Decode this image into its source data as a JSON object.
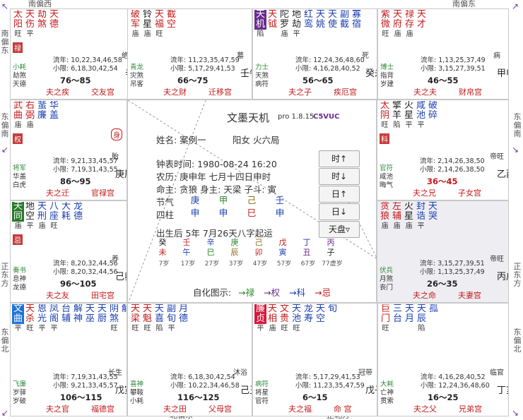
{
  "edges": {
    "top_left": "南偏西",
    "top_right": "南偏东",
    "left_top": "南偏东",
    "left_mid": "东偏南",
    "left_low": "正东方",
    "left_bot": "东偏北",
    "right_mid": "东偏南",
    "right_low": "正东方",
    "right_bot": "东偏北",
    "bottom_left": "北偏东",
    "bottom_right": "正北方"
  },
  "cells": [
    {
      "id": "si",
      "stars": [
        {
          "n": "太阳",
          "b": "旺",
          "c": "red"
        },
        {
          "n": "天伤",
          "b": "平",
          "c": "red"
        },
        {
          "n": "劫煞",
          "b": "",
          "c": "red"
        },
        {
          "n": "天德",
          "b": "",
          "c": "red"
        }
      ],
      "hua": "禄",
      "flow1": "流年: 10,22,34,46,58",
      "flow2": "小限: 6,18,30,42,54",
      "god1": "小耗",
      "god2": "劫煞",
      "god3": "天德",
      "daxian": "76～85",
      "cs": "绝",
      "gz": "辛巳",
      "b1": "夫之疾",
      "b2": "交友宫"
    },
    {
      "id": "wu",
      "stars": [
        {
          "n": "破军",
          "b": "庙",
          "c": "red"
        },
        {
          "n": "铃星",
          "b": "庙",
          "c": "blk"
        },
        {
          "n": "天福",
          "b": "旺",
          "c": "red"
        },
        {
          "n": "截空",
          "b": "",
          "c": "red"
        }
      ],
      "flow1": "流年: 11,23,35,47,59",
      "flow2": "小限: 5,17,29,41,53",
      "god1": "青龙",
      "god2": "灾煞",
      "god3": "吊客",
      "daxian": "66～75",
      "cs": "墓",
      "gz": "壬午",
      "b1": "夫之财",
      "b2": "迁移宫"
    },
    {
      "id": "wei",
      "stars": [
        {
          "n": "天机",
          "b": "陷",
          "c": "hlp"
        },
        {
          "n": "天钺",
          "b": "",
          "c": "red"
        },
        {
          "n": "陀罗",
          "b": "庙",
          "c": "blk"
        },
        {
          "n": "地劫",
          "b": "平",
          "c": "blk"
        },
        {
          "n": "红鸾",
          "b": "",
          "c": "blu"
        },
        {
          "n": "天姚",
          "b": "",
          "c": "blu"
        },
        {
          "n": "天使",
          "b": "",
          "c": "blu"
        },
        {
          "n": "副截",
          "b": "",
          "c": "blu"
        },
        {
          "n": "寡宿",
          "b": "",
          "c": "blu"
        }
      ],
      "flow1": "流年: 12,24,36,48,60",
      "flow2": "小限: 4,16,28,40,52",
      "god1": "力士",
      "god2": "天煞",
      "god3": "病符",
      "daxian": "56～65",
      "cs": "死",
      "gz": "癸未",
      "b1": "夫之子",
      "b2": "疾厄宫"
    },
    {
      "id": "shen",
      "stars": [
        {
          "n": "紫微",
          "b": "旺",
          "c": "red"
        },
        {
          "n": "天府",
          "b": "庙",
          "c": "red"
        },
        {
          "n": "禄存",
          "b": "庙",
          "c": "red"
        },
        {
          "n": "天才",
          "b": "",
          "c": "red"
        }
      ],
      "flow1": "流年: 1,13,25,37,49",
      "flow2": "小限: 3,15,27,39,51",
      "god1": "博士",
      "god2": "指背",
      "god3": "岁建",
      "daxian": "46～55",
      "cs": "病",
      "gz": "甲申",
      "b1": "夫之夫",
      "b2": "财帛宫"
    },
    {
      "id": "chen",
      "stars": [
        {
          "n": "武曲",
          "b": "庙",
          "c": "red"
        },
        {
          "n": "右弼",
          "b": "庙",
          "c": "red"
        },
        {
          "n": "蜚廉",
          "b": "",
          "c": "blu"
        },
        {
          "n": "华盖",
          "b": "",
          "c": "blu"
        }
      ],
      "hua": "权",
      "flow1": "流年: 9,21,33,45,57",
      "flow2": "小限: 7,19,31,43,55",
      "god1": "将军",
      "god2": "华盖",
      "god3": "白虎",
      "daxian": "86～95",
      "cs": "胎",
      "gz": "庚辰",
      "b1": "夫之迁",
      "b2": "官禄宫",
      "tag": "身"
    },
    {
      "id": "you",
      "stars": [
        {
          "n": "太阴",
          "b": "旺",
          "c": "red"
        },
        {
          "n": "擎羊",
          "b": "陷",
          "c": "blk"
        },
        {
          "n": "火星",
          "b": "平",
          "c": "blk"
        },
        {
          "n": "咸池",
          "b": "平",
          "c": "blu"
        },
        {
          "n": "破碎",
          "b": "",
          "c": "blu"
        }
      ],
      "hua": "科",
      "flow1": "流年: 2,14,26,38,50",
      "flow2": "小限: 2,14,26,38,50",
      "god1": "官符",
      "god2": "咸池",
      "god3": "晦气",
      "daxian": "36～45",
      "cs": "帝旺",
      "gz": "乙酉",
      "b1": "夫之兄",
      "b2": "子女宫"
    },
    {
      "id": "mao",
      "stars": [
        {
          "n": "天同",
          "b": "庙",
          "c": "hlg"
        },
        {
          "n": "地空",
          "b": "平",
          "c": "blk"
        },
        {
          "n": "天刑",
          "b": "庙",
          "c": "blu"
        },
        {
          "n": "八座",
          "b": "旺",
          "c": "blu"
        },
        {
          "n": "大耗",
          "b": "",
          "c": "blu"
        },
        {
          "n": "龙德",
          "b": "",
          "c": "blu"
        }
      ],
      "hua": "忌",
      "flow1": "流年: 8,20,32,44,56",
      "flow2": "小限: 8,20,32,44,56",
      "god1": "奏书",
      "god2": "息神",
      "god3": "龙德",
      "daxian": "96～105",
      "cs": "养",
      "gz": "己卯",
      "b1": "夫之友",
      "b2": "田宅宫"
    },
    {
      "id": "xu",
      "stars": [
        {
          "n": "贪狼",
          "b": "庙",
          "c": "red"
        },
        {
          "n": "左辅",
          "b": "庙",
          "c": "red"
        },
        {
          "n": "火星",
          "b": "庙",
          "c": "blk"
        },
        {
          "n": "封诰",
          "b": "平",
          "c": "blu"
        },
        {
          "n": "天哭",
          "b": "",
          "c": "blu"
        }
      ],
      "flow1": "流年: 3,15,27,39,51",
      "flow2": "小限: 1,13,25,37,49",
      "god1": "伏兵",
      "god2": "月煞",
      "god3": "丧门",
      "daxian": "26～35",
      "cs": "帝旺",
      "gz": "丙戌",
      "b1": "夫之命",
      "b2": "夫妻宫",
      "hl": true
    },
    {
      "id": "yin",
      "stars": [
        {
          "n": "文曲",
          "b": "平",
          "c": "hlb"
        },
        {
          "n": "天杀",
          "b": "旺",
          "c": "red"
        },
        {
          "n": "恩光",
          "b": "平",
          "c": "blu"
        },
        {
          "n": "凤阁",
          "b": "平",
          "c": "blu"
        },
        {
          "n": "台辅",
          "b": "",
          "c": "blu"
        },
        {
          "n": "解神",
          "b": "",
          "c": "blu"
        },
        {
          "n": "天巫",
          "b": "",
          "c": "blu"
        },
        {
          "n": "天厨",
          "b": "",
          "c": "blu"
        },
        {
          "n": "阴煞",
          "b": "旺",
          "c": "blu"
        },
        {
          "n": "解",
          "b": "",
          "c": "blu"
        }
      ],
      "flow1": "流年: 7,19,31,43,55",
      "flow2": "小限: 9,21,33,45,57",
      "god1": "飞廉",
      "god2": "岁驿",
      "god3": "岁破",
      "daxian": "106～115",
      "cs": "长生",
      "gz": "戊寅",
      "b1": "夫之官",
      "b2": "福德宫"
    },
    {
      "id": "chou",
      "stars": [
        {
          "n": "天梁",
          "b": "旺",
          "c": "red"
        },
        {
          "n": "天魁",
          "b": "旺",
          "c": "red"
        },
        {
          "n": "天喜",
          "b": "陷",
          "c": "blu"
        },
        {
          "n": "副旬",
          "b": "平",
          "c": "blu"
        },
        {
          "n": "月德",
          "b": "",
          "c": "blu"
        }
      ],
      "flow1": "流年: 6,18,30,42,54",
      "flow2": "小限: 10,22,34,46,58",
      "god1": "喜神",
      "god2": "攀鞍",
      "god3": "小耗",
      "daxian": "116～125",
      "cs": "沐浴",
      "gz": "己丑",
      "b1": "夫之田",
      "b2": "父母宫"
    },
    {
      "id": "zi",
      "stars": [
        {
          "n": "廉贞",
          "b": "平",
          "c": "hlr"
        },
        {
          "n": "天相",
          "b": "庙",
          "c": "red"
        },
        {
          "n": "文贵",
          "b": "旺",
          "c": "red"
        },
        {
          "n": "天池",
          "b": "旺",
          "c": "blu"
        },
        {
          "n": "龙寿",
          "b": "",
          "c": "blu"
        },
        {
          "n": "天空",
          "b": "",
          "c": "blu"
        },
        {
          "n": "旬",
          "b": "",
          "c": "blu"
        }
      ],
      "flow1": "流年: 5,17,29,41,53",
      "flow2": "小限: 11,23,35,47,59",
      "god1": "病符",
      "god2": "将星",
      "god3": "官符",
      "daxian": "6～15",
      "cs": "冠带",
      "gz": "戊子",
      "b1": "夫之福",
      "b2": "命 宫"
    },
    {
      "id": "hai",
      "stars": [
        {
          "n": "巨门",
          "b": "旺",
          "c": "red"
        },
        {
          "n": "三台",
          "b": "",
          "c": "blu"
        },
        {
          "n": "天月",
          "b": "",
          "c": "blu"
        },
        {
          "n": "天辰",
          "b": "陷",
          "c": "blu"
        },
        {
          "n": "孤",
          "b": "",
          "c": "blu"
        }
      ],
      "flow1": "流年: 4,16,28,40,52",
      "flow2": "小限: 12,24,36,48,60",
      "god1": "大耗",
      "god2": "亡神",
      "god3": "贯索",
      "daxian": "16～25",
      "cs": "临官",
      "gz": "丁亥",
      "b1": "夫之父",
      "b2": "兄弟宫"
    }
  ],
  "center": {
    "title": "文墨天机",
    "version": "pro 1.8.15",
    "code": "C5VUC",
    "name_label": "姓名: 案例一",
    "gender": "阳女 火六局",
    "clock": "钟表时间: 1980-08-24 16:20",
    "lunar": "农历: 庚申年 七月十四日申时",
    "ming": "命主: 贪狼 身主: 天梁 子斗: 寅",
    "jieqi_label": "节气",
    "sizhu_label": "四柱",
    "gan": [
      "庚",
      "甲",
      "己",
      "壬"
    ],
    "zhi": [
      "申",
      "申",
      "巳",
      "申"
    ],
    "dayun": "出生后 5年 7月26天八字起运",
    "bazi_top": [
      "癸",
      "壬",
      "辛",
      "庚",
      "己",
      "戊",
      "丁",
      "丙"
    ],
    "bazi_bot": [
      "未",
      "午",
      "巳",
      "辰",
      "卯",
      "寅",
      "丑",
      "子"
    ],
    "bazi_age": [
      "7岁",
      "17岁",
      "27岁",
      "37岁",
      "47岁",
      "57岁",
      "67岁",
      "77虚岁"
    ],
    "legend": "自化图示:",
    "leg1": "→禄",
    "leg2": "→权",
    "leg3": "→科",
    "leg4": "→忌",
    "btn1": "时↑",
    "btn2": "时↓",
    "btn3": "日↑",
    "btn4": "日↓",
    "btn5": "天盘▿"
  },
  "colors": {
    "red": "#c41a1a",
    "blue": "#1a3fb0",
    "purple": "#6a2c8e",
    "green": "#2a7a2a"
  }
}
